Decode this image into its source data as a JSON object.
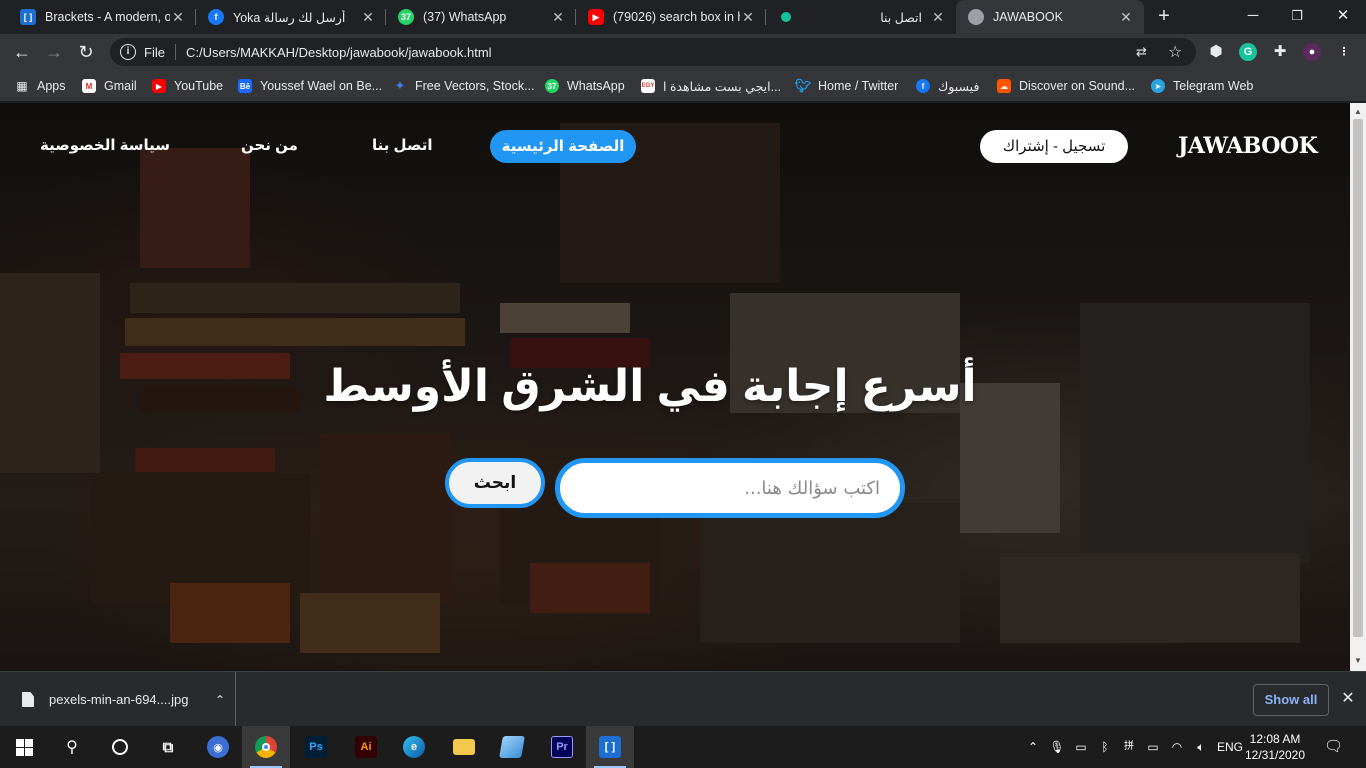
{
  "browser": {
    "tabs": [
      {
        "title": "Brackets - A modern, op",
        "icon": "brackets-icon",
        "color": "#1c6fd1"
      },
      {
        "title": "Yoka أرسل لك رسالة",
        "icon": "facebook-icon",
        "color": "#1877f2"
      },
      {
        "title": "(37) WhatsApp",
        "icon": "whatsapp-icon",
        "color": "#25d366"
      },
      {
        "title": "(79026) search box in ht",
        "icon": "youtube-icon",
        "color": "#ff0000"
      },
      {
        "title": "اتصل بنا",
        "icon": "grammarly-dot-icon",
        "color": "#15c39a"
      },
      {
        "title": "JAWABOOK",
        "icon": "globe-icon",
        "color": "#9aa0a6",
        "active": true
      }
    ],
    "address": {
      "scheme_label": "File",
      "url": "C:/Users/MAKKAH/Desktop/jawabook/jawabook.html"
    },
    "bookmarks": [
      {
        "label": "Apps",
        "icon": "apps-grid-icon"
      },
      {
        "label": "Gmail",
        "icon": "gmail-icon"
      },
      {
        "label": "YouTube",
        "icon": "youtube-icon"
      },
      {
        "label": "Youssef Wael on Be...",
        "icon": "behance-icon"
      },
      {
        "label": "Free Vectors, Stock...",
        "icon": "freepik-icon"
      },
      {
        "label": "WhatsApp",
        "icon": "whatsapp-icon"
      },
      {
        "label": "ايجي بست مشاهدة ا...",
        "icon": "egybest-icon"
      },
      {
        "label": "Home / Twitter",
        "icon": "twitter-icon"
      },
      {
        "label": "فيسبوك",
        "icon": "facebook-icon"
      },
      {
        "label": "Discover on Sound...",
        "icon": "soundcloud-icon"
      },
      {
        "label": "Telegram Web",
        "icon": "telegram-icon"
      }
    ]
  },
  "page": {
    "logo": "JAWABOOK",
    "signup_label": "تسجيل - إشتراك",
    "nav": {
      "home": "الصفحة الرئيسية",
      "contact": "اتصل بنا",
      "about": "من نحن",
      "privacy": "سياسة الخصوصية"
    },
    "headline": "أسرع إجابة في الشرق الأوسط",
    "search": {
      "placeholder": "اكتب سؤالك هنا...",
      "button": "ابحث"
    },
    "colors": {
      "accent": "#2196f3"
    }
  },
  "downloads": {
    "file_name": "pexels-min-an-694....jpg",
    "show_all": "Show all"
  },
  "taskbar": {
    "language": "ENG",
    "time": "12:08 AM",
    "date": "12/31/2020",
    "apps": [
      "start-icon",
      "search-icon",
      "cortana-icon",
      "task-view-icon",
      "app-icon",
      "chrome-icon",
      "photoshop-icon",
      "illustrator-icon",
      "edge-icon",
      "file-explorer-icon",
      "app-icon",
      "premiere-icon",
      "brackets-icon"
    ]
  }
}
